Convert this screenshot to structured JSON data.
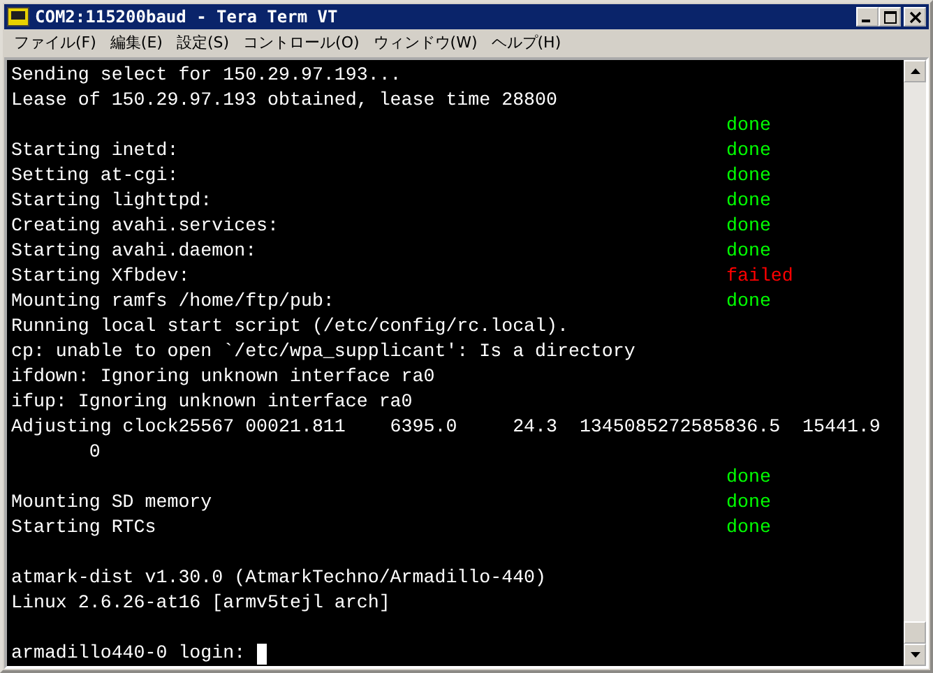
{
  "window": {
    "title": "COM2:115200baud - Tera Term VT"
  },
  "menu": [
    "ファイル(F)",
    "編集(E)",
    "設定(S)",
    "コントロール(O)",
    "ウィンドウ(W)",
    "ヘルプ(H)"
  ],
  "terminal": {
    "lines": [
      {
        "kind": "text",
        "text": "Sending select for 150.29.97.193..."
      },
      {
        "kind": "text",
        "text": "Lease of 150.29.97.193 obtained, lease time 28800"
      },
      {
        "kind": "status",
        "status": {
          "text": "done",
          "failed": false
        }
      },
      {
        "kind": "status",
        "text": "Starting inetd:",
        "status": {
          "text": "done",
          "failed": false
        }
      },
      {
        "kind": "status",
        "text": "Setting at-cgi:",
        "status": {
          "text": "done",
          "failed": false
        }
      },
      {
        "kind": "status",
        "text": "Starting lighttpd:",
        "status": {
          "text": "done",
          "failed": false
        }
      },
      {
        "kind": "status",
        "text": "Creating avahi.services:",
        "status": {
          "text": "done",
          "failed": false
        }
      },
      {
        "kind": "status",
        "text": "Starting avahi.daemon:",
        "status": {
          "text": "done",
          "failed": false
        }
      },
      {
        "kind": "status",
        "text": "Starting Xfbdev:",
        "status": {
          "text": "failed",
          "failed": true
        }
      },
      {
        "kind": "status",
        "text": "Mounting ramfs /home/ftp/pub:",
        "status": {
          "text": "done",
          "failed": false
        }
      },
      {
        "kind": "text",
        "text": "Running local start script (/etc/config/rc.local)."
      },
      {
        "kind": "text",
        "text": "cp: unable to open `/etc/wpa_supplicant': Is a directory"
      },
      {
        "kind": "text",
        "text": "ifdown: Ignoring unknown interface ra0"
      },
      {
        "kind": "text",
        "text": "ifup: Ignoring unknown interface ra0"
      },
      {
        "kind": "text",
        "text": "Adjusting clock25567 00021.811    6395.0     24.3  1345085272585836.5  15441.9"
      },
      {
        "kind": "text",
        "text": "       0"
      },
      {
        "kind": "status",
        "status": {
          "text": "done",
          "failed": false
        }
      },
      {
        "kind": "status",
        "text": "Mounting SD memory",
        "status": {
          "text": "done",
          "failed": false
        }
      },
      {
        "kind": "status",
        "text": "Starting RTCs",
        "status": {
          "text": "done",
          "failed": false
        }
      },
      {
        "kind": "blank"
      },
      {
        "kind": "text",
        "text": "atmark-dist v1.30.0 (AtmarkTechno/Armadillo-440)"
      },
      {
        "kind": "text",
        "text": "Linux 2.6.26-at16 [armv5tejl arch]"
      },
      {
        "kind": "blank"
      },
      {
        "kind": "prompt",
        "text": "armadillo440-0 login: "
      }
    ]
  }
}
